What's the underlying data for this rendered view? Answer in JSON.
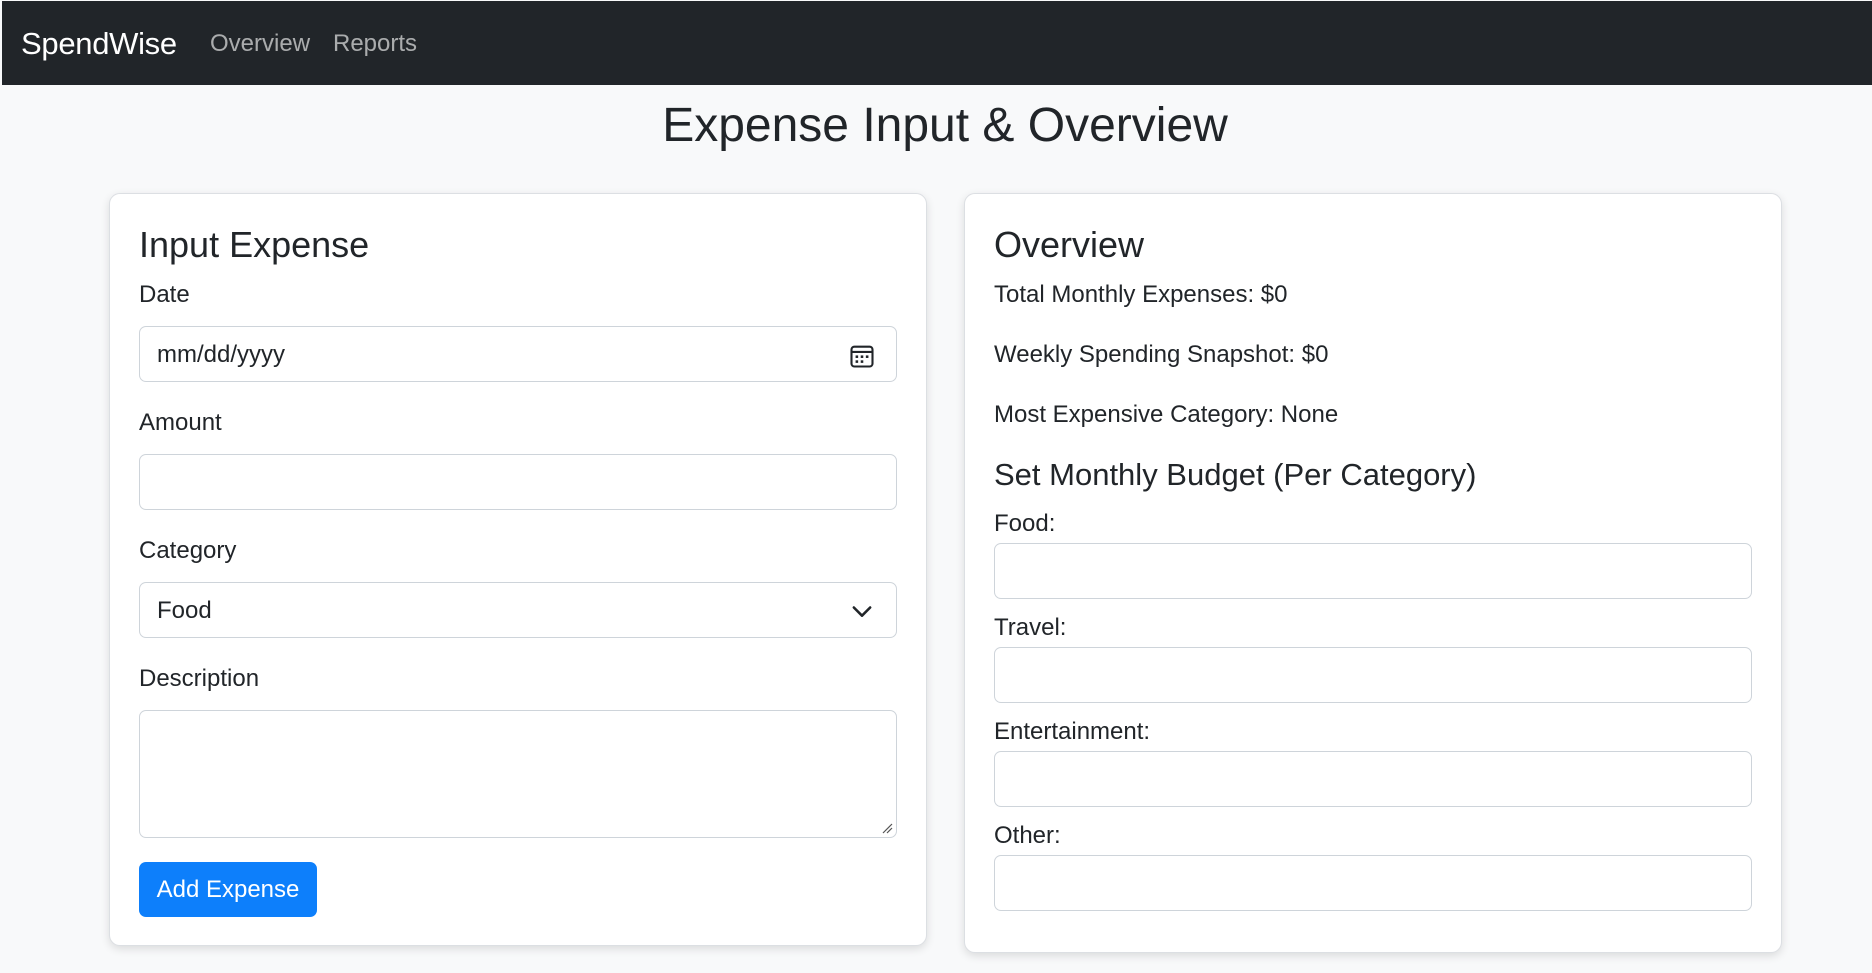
{
  "navbar": {
    "brand": "SpendWise",
    "links": [
      {
        "label": "Overview"
      },
      {
        "label": "Reports"
      }
    ]
  },
  "page": {
    "title": "Expense Input & Overview"
  },
  "input_card": {
    "title": "Input Expense",
    "date": {
      "label": "Date",
      "value": "",
      "placeholder": "mm/dd/yyyy"
    },
    "amount": {
      "label": "Amount",
      "value": ""
    },
    "category": {
      "label": "Category",
      "selected": "Food"
    },
    "description": {
      "label": "Description",
      "value": ""
    },
    "submit_label": "Add Expense"
  },
  "overview_card": {
    "title": "Overview",
    "stats": [
      {
        "text": "Total Monthly Expenses: $0"
      },
      {
        "text": "Weekly Spending Snapshot: $0"
      },
      {
        "text": "Most Expensive Category: None"
      }
    ],
    "budget_title": "Set Monthly Budget (Per Category)",
    "budgets": [
      {
        "label": "Food:",
        "value": ""
      },
      {
        "label": "Travel:",
        "value": ""
      },
      {
        "label": "Entertainment:",
        "value": ""
      },
      {
        "label": "Other:",
        "value": ""
      }
    ]
  },
  "colors": {
    "navbar_bg": "#212529",
    "page_bg": "#f8f9fa",
    "primary": "#0d7ffb"
  }
}
